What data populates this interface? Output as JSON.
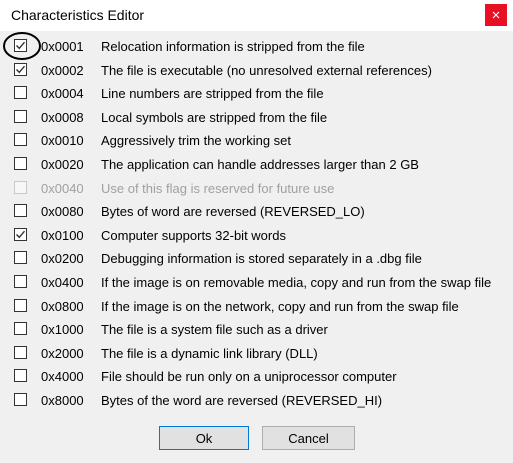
{
  "window": {
    "title": "Characteristics Editor",
    "close_glyph": "×"
  },
  "flags": [
    {
      "code": "0x0001",
      "description": "Relocation information is stripped from the file",
      "checked": true,
      "enabled": true
    },
    {
      "code": "0x0002",
      "description": "The file is executable (no unresolved external references)",
      "checked": true,
      "enabled": true
    },
    {
      "code": "0x0004",
      "description": "Line numbers are stripped from the file",
      "checked": false,
      "enabled": true
    },
    {
      "code": "0x0008",
      "description": "Local symbols are stripped from the file",
      "checked": false,
      "enabled": true
    },
    {
      "code": "0x0010",
      "description": "Aggressively trim the working set",
      "checked": false,
      "enabled": true
    },
    {
      "code": "0x0020",
      "description": "The application can handle addresses larger than 2 GB",
      "checked": false,
      "enabled": true
    },
    {
      "code": "0x0040",
      "description": "Use of this flag is reserved for future use",
      "checked": false,
      "enabled": false
    },
    {
      "code": "0x0080",
      "description": "Bytes of word are reversed (REVERSED_LO)",
      "checked": false,
      "enabled": true
    },
    {
      "code": "0x0100",
      "description": "Computer supports 32-bit words",
      "checked": true,
      "enabled": true
    },
    {
      "code": "0x0200",
      "description": "Debugging information is stored separately in a .dbg file",
      "checked": false,
      "enabled": true
    },
    {
      "code": "0x0400",
      "description": "If the image is on removable media, copy and run from the swap file",
      "checked": false,
      "enabled": true
    },
    {
      "code": "0x0800",
      "description": "If the image is on the network, copy and run from the swap file",
      "checked": false,
      "enabled": true
    },
    {
      "code": "0x1000",
      "description": "The file is a system file such as a driver",
      "checked": false,
      "enabled": true
    },
    {
      "code": "0x2000",
      "description": "The file is a dynamic link library (DLL)",
      "checked": false,
      "enabled": true
    },
    {
      "code": "0x4000",
      "description": "File should be run only on a uniprocessor computer",
      "checked": false,
      "enabled": true
    },
    {
      "code": "0x8000",
      "description": "Bytes of the word are reversed (REVERSED_HI)",
      "checked": false,
      "enabled": true
    }
  ],
  "buttons": {
    "ok_label": "Ok",
    "cancel_label": "Cancel"
  },
  "colors": {
    "close_bg": "#e81123",
    "ok_border": "#0078d7",
    "disabled_text": "#a0a0a0"
  }
}
